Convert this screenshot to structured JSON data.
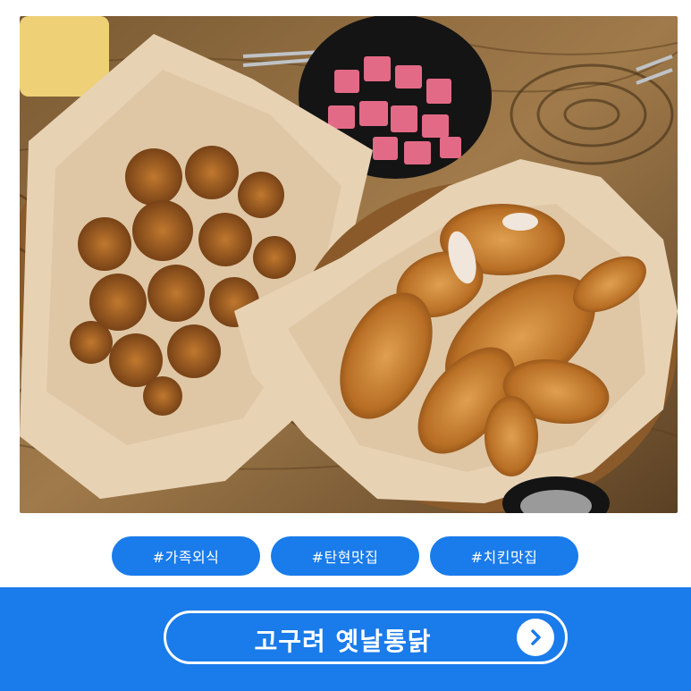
{
  "tags": [
    {
      "label": "#가족외식"
    },
    {
      "label": "#탄현맛집"
    },
    {
      "label": "#치킨맛집"
    }
  ],
  "banner": {
    "title": "고구려 옛날통닭",
    "arrow_icon": "chevron-right-icon"
  },
  "colors": {
    "accent": "#1a7bea",
    "text_on_accent": "#ffffff"
  }
}
